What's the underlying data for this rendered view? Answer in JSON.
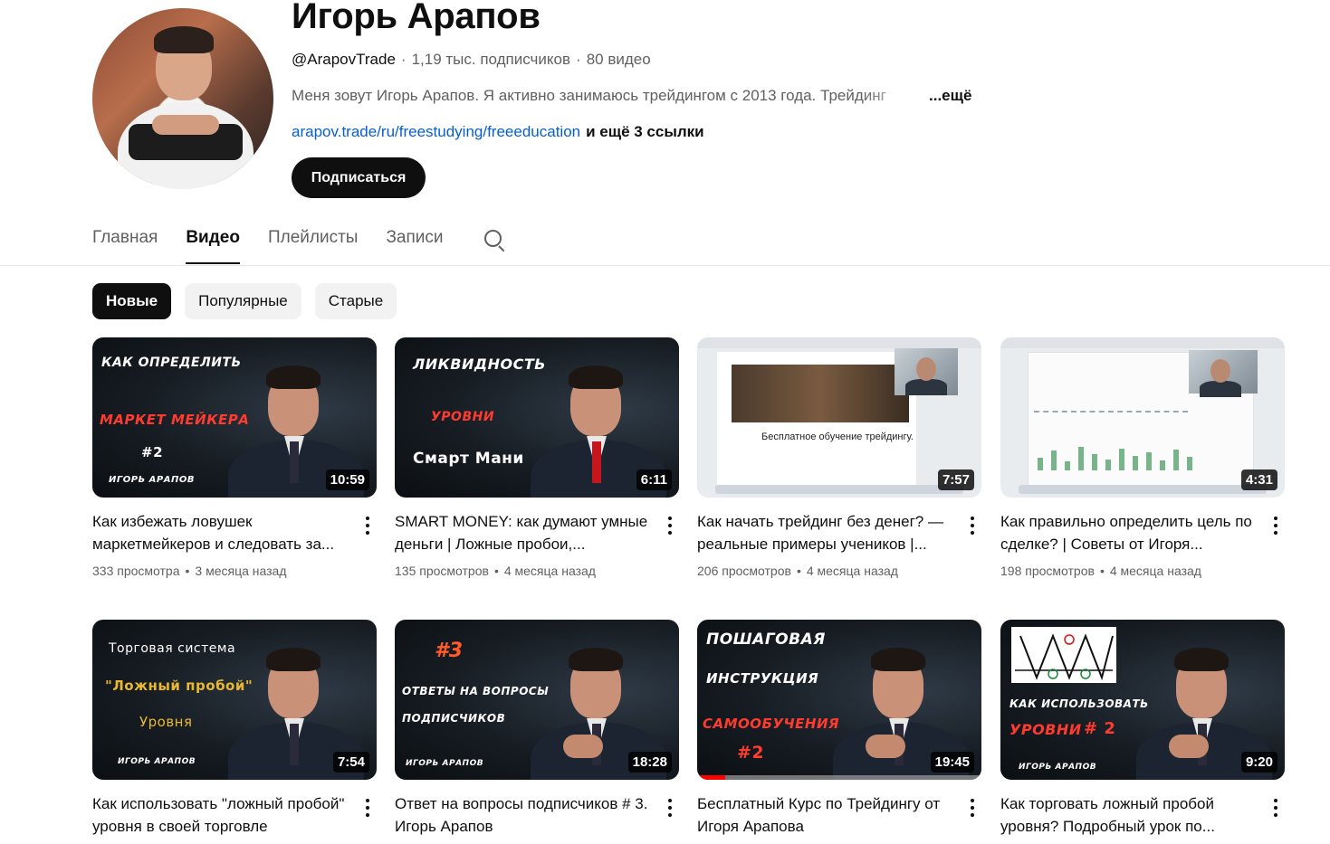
{
  "channel": {
    "title": "Игорь Арапов",
    "handle": "@ArapovTrade",
    "subscribers": "1,19 тыс. подписчиков",
    "video_count": "80 видео",
    "description": "Меня зовут Игорь Арапов. Я активно занимаюсь  трейдингом с 2013 года. Трейдинг",
    "description_more": "...ещё",
    "link": "arapov.trade/ru/freestudying/freeeducation",
    "link_extra": "и ещё 3 ссылки",
    "subscribe_label": "Подписаться"
  },
  "tabs": [
    {
      "label": "Главная",
      "active": false
    },
    {
      "label": "Видео",
      "active": true
    },
    {
      "label": "Плейлисты",
      "active": false
    },
    {
      "label": "Записи",
      "active": false
    }
  ],
  "tab_search_icon": "search-icon",
  "chips": [
    {
      "label": "Новые",
      "active": true
    },
    {
      "label": "Популярные",
      "active": false
    },
    {
      "label": "Старые",
      "active": false
    }
  ],
  "videos": [
    {
      "title": "Как избежать ловушек маркетмейкеров и следовать за...",
      "views": "333 просмотра",
      "age": "3 месяца назад",
      "duration": "10:59",
      "overlay": [
        "КАК ОПРЕДЕЛИТЬ",
        "МАРКЕТ МЕЙКЕРА",
        "#2",
        "ИГОРЬ АРАПОВ"
      ]
    },
    {
      "title": "SMART MONEY: как думают умные деньги | Ложные пробои,...",
      "views": "135 просмотров",
      "age": "4 месяца назад",
      "duration": "6:11",
      "overlay": [
        "ЛИКВИДНОСТЬ",
        "УРОВНИ",
        "Смарт Мани"
      ]
    },
    {
      "title": "Как начать трейдинг без денег? — реальные примеры учеников |...",
      "views": "206 просмотров",
      "age": "4 месяца назад",
      "duration": "7:57",
      "overlay": [
        "Бесплатное обучение трейдингу."
      ]
    },
    {
      "title": "Как правильно определить цель по сделке? | Советы от Игоря...",
      "views": "198 просмотров",
      "age": "4 месяца назад",
      "duration": "4:31",
      "overlay": []
    },
    {
      "title": "Как использовать \"ложный пробой\" уровня в своей торговле",
      "views": "",
      "age": "",
      "duration": "7:54",
      "overlay": [
        "Торговая система",
        "\"Ложный пробой\"",
        "Уровня",
        "ИГОРЬ АРАПОВ"
      ]
    },
    {
      "title": "Ответ на вопросы подписчиков # 3. Игорь Арапов",
      "views": "",
      "age": "",
      "duration": "18:28",
      "overlay": [
        "#3",
        "ОТВЕТЫ НА ВОПРОСЫ",
        "ПОДПИСЧИКОВ",
        "ИГОРЬ АРАПОВ"
      ]
    },
    {
      "title": "Бесплатный Курс по Трейдингу от Игоря Арапова",
      "views": "",
      "age": "",
      "duration": "19:45",
      "watched_fraction": 0.1,
      "overlay": [
        "ПОШАГОВАЯ",
        "ИНСТРУКЦИЯ",
        "САМООБУЧЕНИЯ",
        "#2"
      ]
    },
    {
      "title": "Как торговать ложный пробой уровня? Подробный урок по...",
      "views": "",
      "age": "",
      "duration": "9:20",
      "overlay": [
        "КАК ИСПОЛЬЗОВАТЬ",
        "УРОВНИ",
        "# 2",
        "ИГОРЬ АРАПОВ"
      ]
    }
  ],
  "colors": {
    "link": "#065fd4",
    "primary_text": "#0f0f0f",
    "secondary_text": "#606060",
    "progress_red": "#ff0000"
  }
}
